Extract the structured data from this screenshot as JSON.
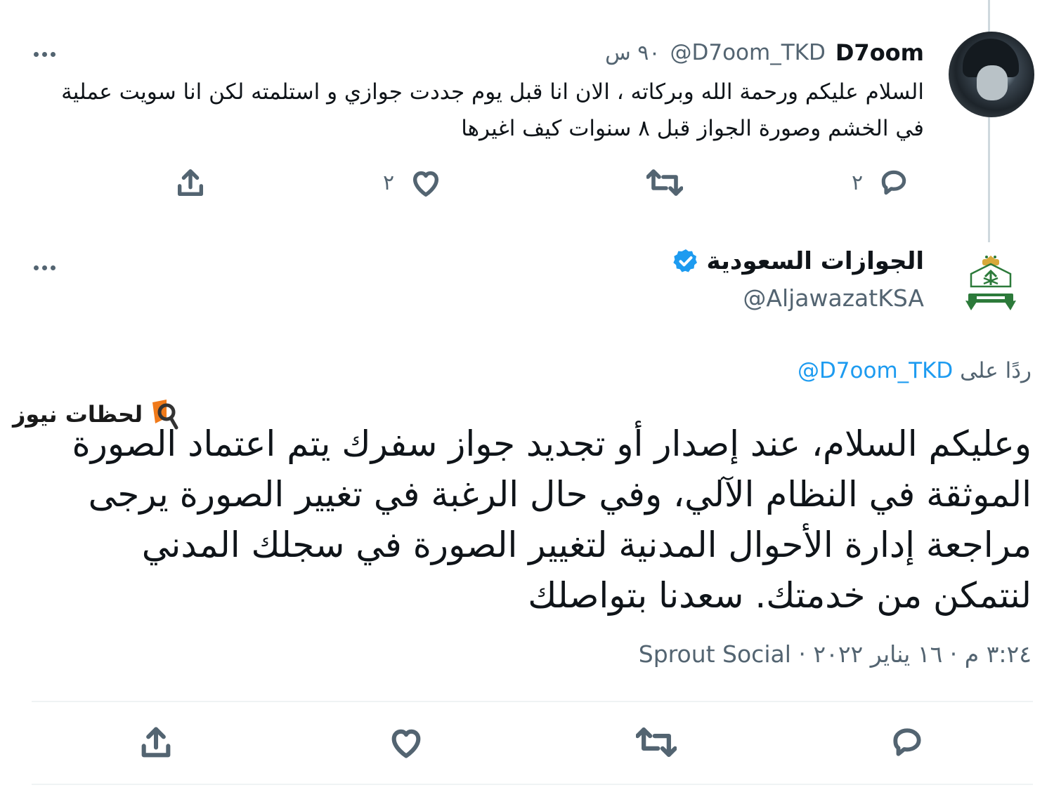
{
  "parent_tweet": {
    "name": "D7oom",
    "handle": "@D7oom_TKD",
    "time": "٩٠ س",
    "text": "السلام عليكم ورحمة الله وبركاته ، الان انا قبل يوم جددت جوازي و استلمته لكن انا سويت عملية في الخشم وصورة الجواز قبل ٨ سنوات كيف اغيرها",
    "reply_count": "٢",
    "like_count": "٢",
    "more_label": "..."
  },
  "reply_tweet": {
    "name": "الجوازات السعودية",
    "handle": "@AljawazatKSA",
    "verified": true,
    "replying_prefix": "ردًا على",
    "replying_to": "@D7oom_TKD",
    "text": "وعليكم السلام، عند إصدار أو تجديد جواز سفرك يتم اعتماد الصورة الموثقة في النظام الآلي، وفي حال الرغبة في تغيير الصورة يرجى مراجعة إدارة الأحوال المدنية لتغيير الصورة في سجلك المدني لنتمكن من خدمتك. سعدنا بتواصلك",
    "timestamp": "٣:٢٤ م · ١٦ يناير ٢٠٢٢ · Sprout Social",
    "more_label": "..."
  },
  "watermark": {
    "text": "لحظات نيوز"
  },
  "icons": {
    "reply": "reply-icon",
    "retweet": "retweet-icon",
    "like": "like-icon",
    "share": "share-icon",
    "more": "more-icon",
    "verified": "verified-badge-icon"
  },
  "colors": {
    "text": "#0f1419",
    "secondary": "#536471",
    "accent": "#1d9bf0",
    "divider": "#eff3f4",
    "watermark_orange": "#f07a1a"
  }
}
